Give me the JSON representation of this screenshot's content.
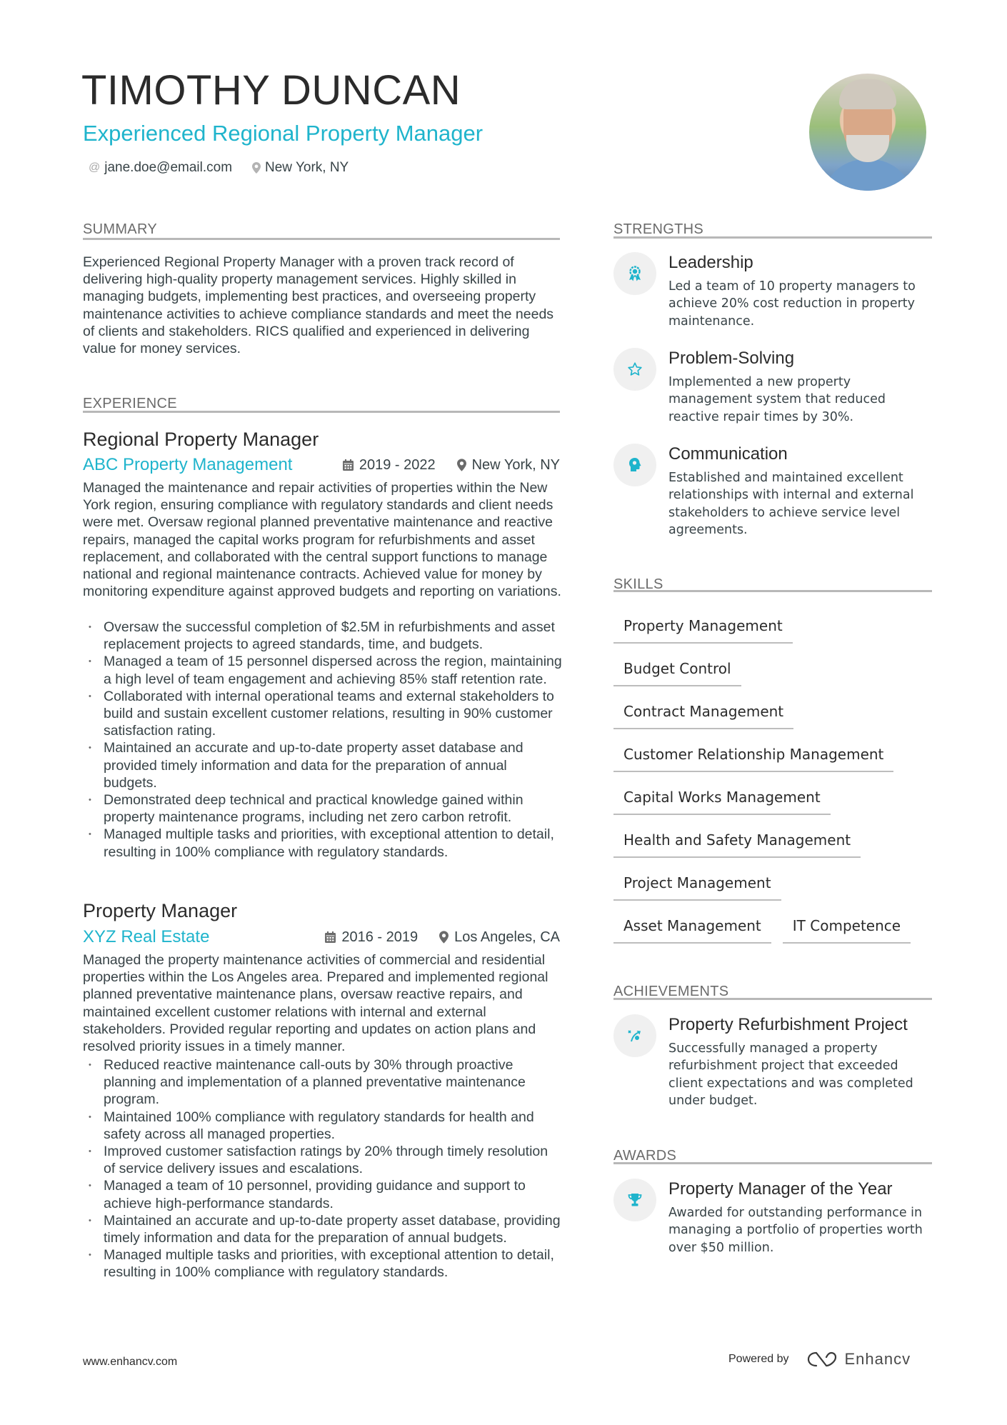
{
  "header": {
    "name": "TIMOTHY DUNCAN",
    "headline": "Experienced Regional Property Manager",
    "email": "jane.doe@email.com",
    "location": "New York, NY",
    "photo_alt": "Profile photo"
  },
  "colors": {
    "accent": "#1fb4cc",
    "text": "#384347",
    "heading": "#2b2b2b",
    "rule": "#b8b8b8",
    "icon_bg": "#f0f0f0"
  },
  "summary": {
    "title": "SUMMARY",
    "text": "Experienced Regional Property Manager with a proven track record of delivering high-quality property management services. Highly skilled in managing budgets, implementing best practices, and overseeing property maintenance activities to achieve compliance standards and meet the needs of clients and stakeholders. RICS qualified and experienced in delivering value for money services."
  },
  "experience": {
    "title": "EXPERIENCE",
    "jobs": [
      {
        "role": "Regional Property Manager",
        "company": "ABC Property Management",
        "dates": "2019 - 2022",
        "location": "New York, NY",
        "description": "Managed the maintenance and repair activities of properties within the New York region, ensuring compliance with regulatory standards and client needs were met. Oversaw regional planned preventative maintenance and reactive repairs, managed the capital works program for refurbishments and asset replacement, and collaborated with the central support functions to manage national and regional maintenance contracts. Achieved value for money by monitoring expenditure against approved budgets and reporting on variations.",
        "bullets": [
          "Oversaw the successful completion of $2.5M in refurbishments and asset replacement projects to agreed standards, time, and budgets.",
          "Managed a team of 15 personnel dispersed across the region, maintaining a high level of team engagement and achieving 85% staff retention rate.",
          "Collaborated with internal operational teams and external stakeholders to build and sustain excellent customer relations, resulting in 90% customer satisfaction rating.",
          "Maintained an accurate and up-to-date property asset database and provided timely information and data for the preparation of annual budgets.",
          "Demonstrated deep technical and practical knowledge gained within property maintenance programs, including net zero carbon retrofit.",
          "Managed multiple tasks and priorities, with exceptional attention to detail, resulting in 100% compliance with regulatory standards."
        ]
      },
      {
        "role": "Property Manager",
        "company": "XYZ Real Estate",
        "dates": "2016 - 2019",
        "location": "Los Angeles, CA",
        "description": "Managed the property maintenance activities of commercial and residential properties within the Los Angeles area. Prepared and implemented regional planned preventative maintenance plans, oversaw reactive repairs, and maintained excellent customer relations with internal and external stakeholders. Provided regular reporting and updates on action plans and resolved priority issues in a timely manner.",
        "bullets": [
          "Reduced reactive maintenance call-outs by 30% through proactive planning and implementation of a planned preventative maintenance program.",
          "Maintained 100% compliance with regulatory standards for health and safety across all managed properties.",
          "Improved customer satisfaction ratings by 20% through timely resolution of service delivery issues and escalations.",
          "Managed a team of 10 personnel, providing guidance and support to achieve high-performance standards.",
          "Maintained an accurate and up-to-date property asset database, providing timely information and data for the preparation of annual budgets.",
          "Managed multiple tasks and priorities, with exceptional attention to detail, resulting in 100% compliance with regulatory standards."
        ]
      }
    ]
  },
  "strengths": {
    "title": "STRENGTHS",
    "items": [
      {
        "icon": "award-ribbon-icon",
        "title": "Leadership",
        "description": "Led a team of 10 property managers to achieve 20% cost reduction in property maintenance."
      },
      {
        "icon": "star-icon",
        "title": "Problem-Solving",
        "description": "Implemented a new property management system that reduced reactive repair times by 30%."
      },
      {
        "icon": "head-brain-icon",
        "title": "Communication",
        "description": "Established and maintained excellent relationships with internal and external stakeholders to achieve service level agreements."
      }
    ]
  },
  "skills": {
    "title": "SKILLS",
    "items": [
      "Property Management",
      "Budget Control",
      "Contract Management",
      "Customer Relationship Management",
      "Capital Works Management",
      "Health and Safety Management",
      "Project Management",
      "Asset Management",
      "IT Competence"
    ]
  },
  "achievements": {
    "title": "ACHIEVEMENTS",
    "items": [
      {
        "icon": "strategy-path-icon",
        "title": "Property Refurbishment Project",
        "description": "Successfully managed a property refurbishment project that exceeded client expectations and was completed under budget."
      }
    ]
  },
  "awards": {
    "title": "AWARDS",
    "items": [
      {
        "icon": "trophy-icon",
        "title": "Property Manager of the Year",
        "description": "Awarded for outstanding performance in managing a portfolio of properties worth over $50 million."
      }
    ]
  },
  "footer": {
    "website": "www.enhancv.com",
    "powered_by": "Powered by",
    "brand": "Enhancv"
  }
}
